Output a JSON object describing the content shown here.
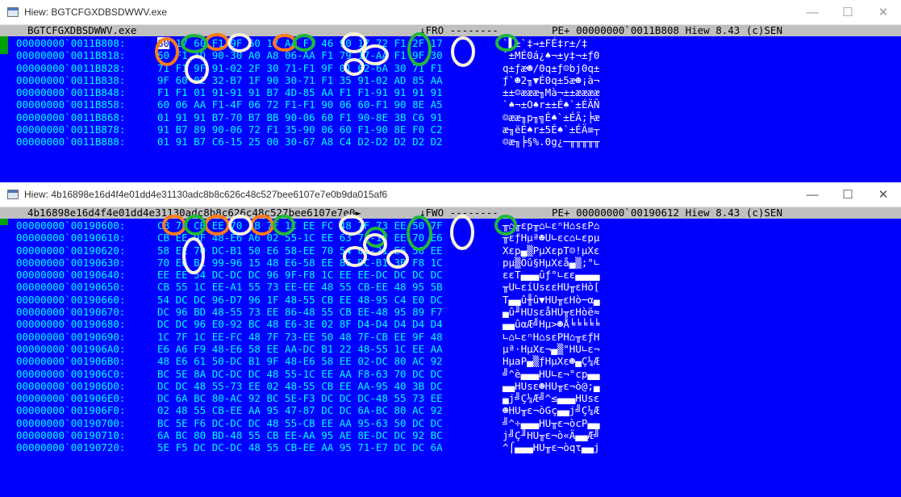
{
  "window_a": {
    "title": "Hiew: BGTCFGXDBSDWWV.exe",
    "controls": {
      "minimize": "—",
      "maximize": "☐",
      "close": "✕"
    },
    "status": {
      "filename": "BGTCFGXDBSDWWV.exe",
      "mode": "↓FRO --------",
      "info": "PE+ 00000000`0011B808 Hiew 8.43 (c)SEN"
    },
    "rows": [
      {
        "offset": "00000000`0011B808:",
        "bytes": "60 17 60 F1 9F 60 17 AA F1 46 90 17 72 F1 2F 17",
        "ascii": "`▌±`‡→±FÉ‡r±/‡"
      },
      {
        "offset": "00000000`0011B818:",
        "bytes": "60 F1 4D 90-30 A0 A8 06-AA F1 79 17-AA F1 9F 30",
        "ascii": "`±MÉ0á¿♠¬±y‡¬±ƒ0"
      },
      {
        "offset": "00000000`0011B828:",
        "bytes": "71 F1 9F 91-02 2F 30 71-F1 9F 01 62-6A 30 71 F1",
        "ascii": "q±ƒæ☻/0q±ƒ☺bj0q±"
      },
      {
        "offset": "00000000`0011B838:",
        "bytes": "9F 60 02 32-B7 1F 90 30-71 F1 35 91-02 AD 85 AA",
        "ascii": "ƒ`☻2╖▼É0q±5æ☻¡à¬"
      },
      {
        "offset": "00000000`0011B848:",
        "bytes": "F1 F1 01 91-91 91 B7 4D-85 AA F1 F1-91 91 91 91",
        "ascii": "±±☺æææ╖Mà¬±±ææææ"
      },
      {
        "offset": "00000000`0011B858:",
        "bytes": "60 06 AA F1-4F 06 72 F1-F1 90 06 60-F1 90 8E A5",
        "ascii": "`♠¬±O♠r±±É♠`±ÉÄÑ"
      },
      {
        "offset": "00000000`0011B868:",
        "bytes": "01 91 91 B7-70 B7 BB 90-06 60 F1 90-8E 3B C6 91",
        "ascii": "☺ææ╖p╖╗É♠`±ÉÄ;╞æ"
      },
      {
        "offset": "00000000`0011B878:",
        "bytes": "91 B7 89 90-06 72 F1 35-90 06 60 F1-90 8E F0 C2",
        "ascii": "æ╖ëÉ♠r±5É♠`±ÉÄ≡┬"
      },
      {
        "offset": "00000000`0011B888:",
        "bytes": "01 91 B7 C6-15 25 00 30-67 A8 C4 D2-D2 D2 D2 D2",
        "ascii": "☺æ╖╞§%.0g¿─╥╥╥╥╥"
      }
    ]
  },
  "window_b": {
    "title": "Hiew: 4b16898e16d4f4e01dd4e31130adc8b8c626c48c527bee6107e7e0b9da015af6",
    "controls": {
      "minimize": "—",
      "maximize": "☐",
      "close": "✕"
    },
    "status": {
      "filename": "4b16898e16d4f4e01dd4e31130adc8b8c626c48c527bee6107e7e0►",
      "mode": "↓FWO --------",
      "info": "PE+ 00000000`00190612 Hiew 8.43 (c)SEN"
    },
    "rows": [
      {
        "offset": "00000000`00190600:",
        "bytes": "CB 7F CB EE 70 CB 7F 1C EE FC 48 7F 73 EE 50 7F",
        "ascii": "╥⌂╥εp╥⌂∟εⁿH⌂sεP⌂"
      },
      {
        "offset": "00000000`00190610:",
        "bytes": "CB EE 9F 48-E6 A6 02 55-1C EE 63 7F-1C EE 70 E6",
        "ascii": "╥εƒHµª☻U∟εc⌂∟εpµ"
      },
      {
        "offset": "00000000`00190620:",
        "bytes": "58 EE 70 DC-B1 50 E6 58-EE 70 54 01-21 E6 58 EE",
        "ascii": "Xεp▄▒PµXεpT☺!µXε"
      },
      {
        "offset": "00000000`00190630:",
        "bytes": "70 E6 B1 99-96 15 48 E6-58 EE 86 DC-B1 3B F8 1C",
        "ascii": "pµ▒Öû§HµXεå▄▒;°∟"
      },
      {
        "offset": "00000000`00190640:",
        "bytes": "EE EE 54 DC-DC DC 96 9F-F8 1C EE EE-DC DC DC DC",
        "ascii": "εεT▄▄▄ûƒ°∟εε▄▄▄▄"
      },
      {
        "offset": "00000000`00190650:",
        "bytes": "CB 55 1C EE-A1 55 73 EE-EE 48 55 CB-EE 48 95 5B",
        "ascii": "╥U∟εíUsεεHU╥εHò["
      },
      {
        "offset": "00000000`00190660:",
        "bytes": "54 DC DC 96-D7 96 1F 48-55 CB EE 48-95 C4 E0 DC",
        "ascii": "T▄▄û╫û▼HU╥εHò─α▄"
      },
      {
        "offset": "00000000`00190670:",
        "bytes": "DC 96 BD 48-55 73 EE 86-48 55 CB EE-48 95 89 F7",
        "ascii": "▄û╜HUsεåHU╥εHòë≈"
      },
      {
        "offset": "00000000`00190680:",
        "bytes": "DC DC 96 E0-92 BC 48 E6-3E 02 8F D4-D4 D4 D4 D4",
        "ascii": "▄▄ûαÆ╝Hµ>☻Å╘╘╘╘╘"
      },
      {
        "offset": "00000000`00190690:",
        "bytes": "1C 7F 1C EE-FC 48 7F 73-EE 50 48 7F-CB EE 9F 48",
        "ascii": "∟⌂∟εⁿH⌂sεPH⌂╥εƒH"
      },
      {
        "offset": "00000000`001906A0:",
        "bytes": "E6 A6 F9 48-E6 58 EE AA-DC B1 22 48-55 1C EE AA",
        "ascii": "µª·HµXε¬▄▒\"HU∟ε¬"
      },
      {
        "offset": "00000000`001906B0:",
        "bytes": "48 E6 61 50-DC B1 9F 48-E6 58 EE 02-DC 80 AC 92",
        "ascii": "HµaP▄▒ƒHµXε☻▄Ç¼Æ"
      },
      {
        "offset": "00000000`001906C0:",
        "bytes": "BC 5E 8A DC-DC DC 48 55-1C EE AA F8-63 70 DC DC",
        "ascii": "╝^è▄▄▄HU∟ε¬°cp▄▄"
      },
      {
        "offset": "00000000`001906D0:",
        "bytes": "DC DC 48 55-73 EE 02 48-55 CB EE AA-95 40 3B DC",
        "ascii": "▄▄HUsε☻HU╥ε¬ò@;▄"
      },
      {
        "offset": "00000000`001906E0:",
        "bytes": "DC 6A BC 80-AC 92 BC 5E-F3 DC DC DC-48 55 73 EE",
        "ascii": "▄j╝Ç¼Æ╝^≤▄▄▄HUsε"
      },
      {
        "offset": "00000000`001906F0:",
        "bytes": "02 48 55 CB-EE AA 95 47-87 DC DC 6A-BC 80 AC 92",
        "ascii": "☻HU╥ε¬òGç▄▄j╝Ç¼Æ"
      },
      {
        "offset": "00000000`00190700:",
        "bytes": "BC 5E F6 DC-DC DC 48 55-CB EE AA 95-63 50 DC DC",
        "ascii": "╝^÷▄▄▄HU╥ε¬òcP▄▄"
      },
      {
        "offset": "00000000`00190710:",
        "bytes": "6A BC 80 BD-48 55 CB EE-AA 95 AE 8E-DC DC 92 BC",
        "ascii": "j╝Ç╜HU╥ε¬ò«Ä▄▄Æ╝"
      },
      {
        "offset": "00000000`00190720:",
        "bytes": "5E F5 DC DC-DC 48 55 CB-EE AA 95 71-E7 DC DC 6A",
        "ascii": "^⌠▄▄▄HU╥ε¬òqτ▄▄j"
      }
    ]
  },
  "annotation_colors": {
    "orange": "#ff7a1a",
    "green": "#1fb83a",
    "cream": "#fbf4dc"
  }
}
